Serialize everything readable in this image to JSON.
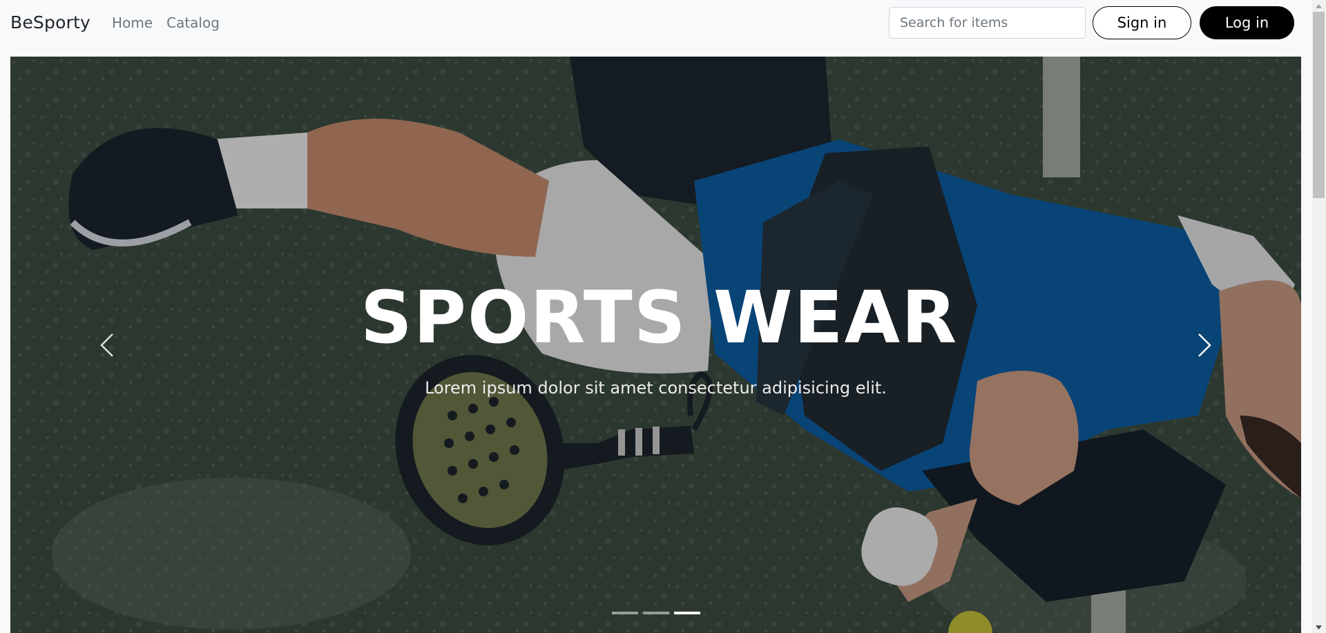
{
  "navbar": {
    "brand": "BeSporty",
    "links": [
      "Home",
      "Catalog"
    ],
    "search_placeholder": "Search for items",
    "search_value": "",
    "signin_label": "Sign in",
    "login_label": "Log in"
  },
  "hero": {
    "title": "SPORTS WEAR",
    "subtitle": "Lorem ipsum dolor sit amet consectetur adipisicing elit.",
    "prev_icon": "chevron-left-icon",
    "next_icon": "chevron-right-icon",
    "slides_count": 3,
    "active_slide": 3
  },
  "colors": {
    "navbar_bg": "#f8f9fa",
    "court_green": "#3c4c40",
    "shirt_blue": "#0d5fa6",
    "button_dark": "#000000"
  }
}
